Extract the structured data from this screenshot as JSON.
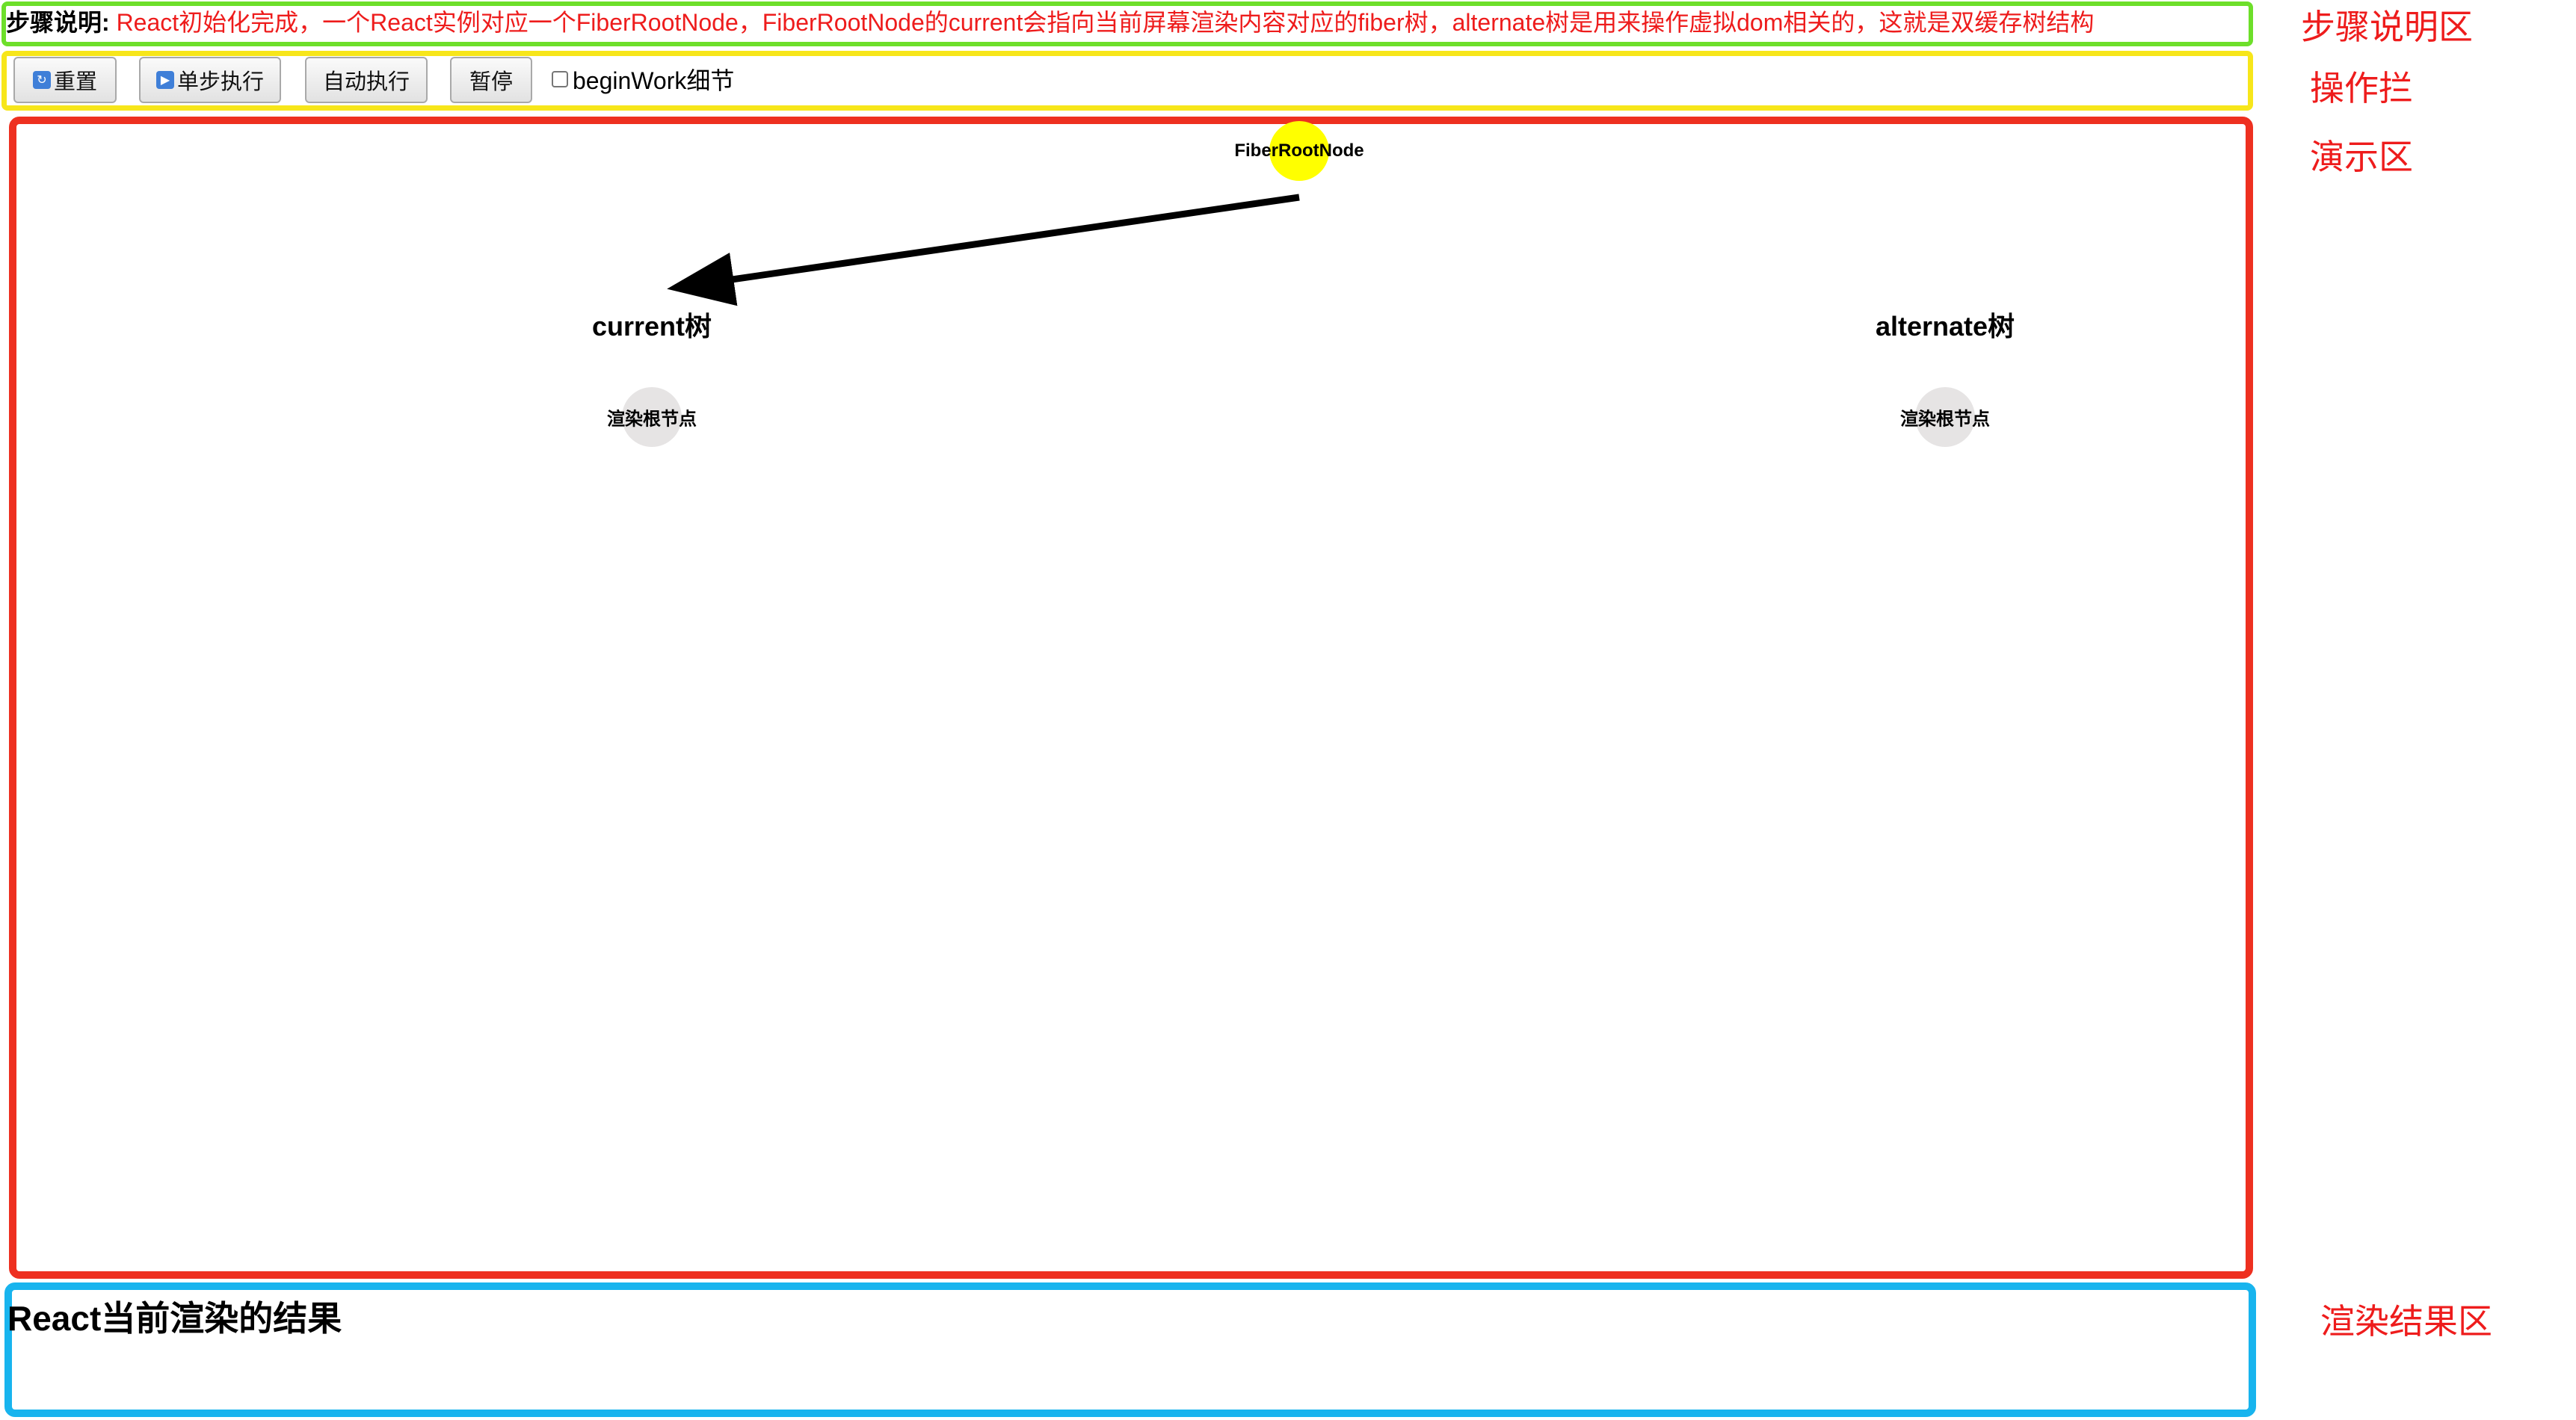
{
  "step": {
    "label": "步骤说明:",
    "description": "React初始化完成，一个React实例对应一个FiberRootNode，FiberRootNode的current会指向当前屏幕渲染内容对应的fiber树，alternate树是用来操作虚拟dom相关的，这就是双缓存树结构"
  },
  "toolbar": {
    "reset_label": "重置",
    "step_label": "单步执行",
    "auto_label": "自动执行",
    "pause_label": "暂停",
    "beginwork_label": "beginWork细节",
    "beginwork_checked": false
  },
  "demo": {
    "fiber_root_label": "FiberRootNode",
    "current_tree_title": "current树",
    "alternate_tree_title": "alternate树",
    "current_root_label": "渲染根节点",
    "alternate_root_label": "渲染根节点"
  },
  "result": {
    "title": "React当前渲染的结果"
  },
  "side_labels": {
    "step_area": "步骤说明区",
    "toolbar_area": "操作拦",
    "demo_area": "演示区",
    "result_area": "渲染结果区"
  },
  "colors": {
    "step_border": "#6ddf2a",
    "toolbar_border": "#f7e61a",
    "demo_border": "#ee3020",
    "result_border": "#18b4ee",
    "fiber_root_node": "#ffff00",
    "tree_node": "#e6e4e4",
    "annotation_text": "#ee1c1c"
  },
  "icons": {
    "reset": "reset-icon",
    "step": "play-icon"
  }
}
